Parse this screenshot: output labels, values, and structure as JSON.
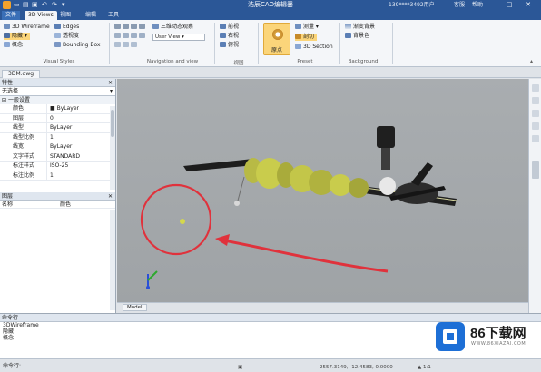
{
  "titlebar": {
    "title": "浩辰CAD编辑器",
    "user": "139****3492用户",
    "menu_links": [
      "客服",
      "帮助"
    ],
    "quick_access_icons": [
      "new-icon",
      "open-icon",
      "save-icon",
      "undo-icon",
      "redo-icon"
    ]
  },
  "tabs": {
    "file": "文件",
    "items": [
      "3D Views",
      "视图",
      "编辑",
      "工具"
    ],
    "active_index": 0
  },
  "ribbon": {
    "visual_styles": {
      "items": [
        "3D Wireframe",
        "隐藏",
        "概念",
        "Edges",
        "透视度",
        "Bounding Box"
      ],
      "label": "Visual Styles"
    },
    "navigation": {
      "items": [
        "三维动态观察",
        "User View"
      ],
      "label": "Navigation and view"
    },
    "views": {
      "items": [
        "前视",
        "右视",
        "俯视"
      ],
      "label": "视图"
    },
    "preset": {
      "big_button": "原点",
      "items": [
        "测量",
        "剖切"
      ],
      "label": "Preset",
      "section_item": "3D Section"
    },
    "background": {
      "items": [
        "渐变背景",
        "背景色"
      ],
      "label": "Background"
    }
  },
  "document": {
    "tab": "3DM.dwg"
  },
  "properties": {
    "header": "特性",
    "selector": "无选择",
    "section": "一般设置",
    "rows": [
      {
        "key": "颜色",
        "value": "■ ByLayer"
      },
      {
        "key": "图层",
        "value": "0"
      },
      {
        "key": "线型",
        "value": "ByLayer"
      },
      {
        "key": "线型比例",
        "value": "1"
      },
      {
        "key": "线宽",
        "value": "ByLayer"
      },
      {
        "key": "文字样式",
        "value": "STANDARD"
      },
      {
        "key": "标注样式",
        "value": "ISO-25"
      },
      {
        "key": "标注比例",
        "value": "1"
      }
    ]
  },
  "layers": {
    "header": "图层",
    "columns": [
      "名称",
      "颜色"
    ]
  },
  "viewport": {
    "model_tab": "Model"
  },
  "command": {
    "header": "命令行",
    "lines": [
      "3DWireframe",
      "隐藏",
      "概念"
    ],
    "prompt_label": "命令行:"
  },
  "status": {
    "coords": "2557.3149, -12.4583, 0.0000",
    "extra": "▲ 1:1"
  },
  "watermark": {
    "brand": "86下载网",
    "url": "WWW.86XIAZAI.COM"
  },
  "colors": {
    "title_bar": "#2b5797",
    "annotation_red": "#e0323c",
    "model_yellow": "#c9cc4c",
    "viewport_bg": "#a4a8ab"
  }
}
